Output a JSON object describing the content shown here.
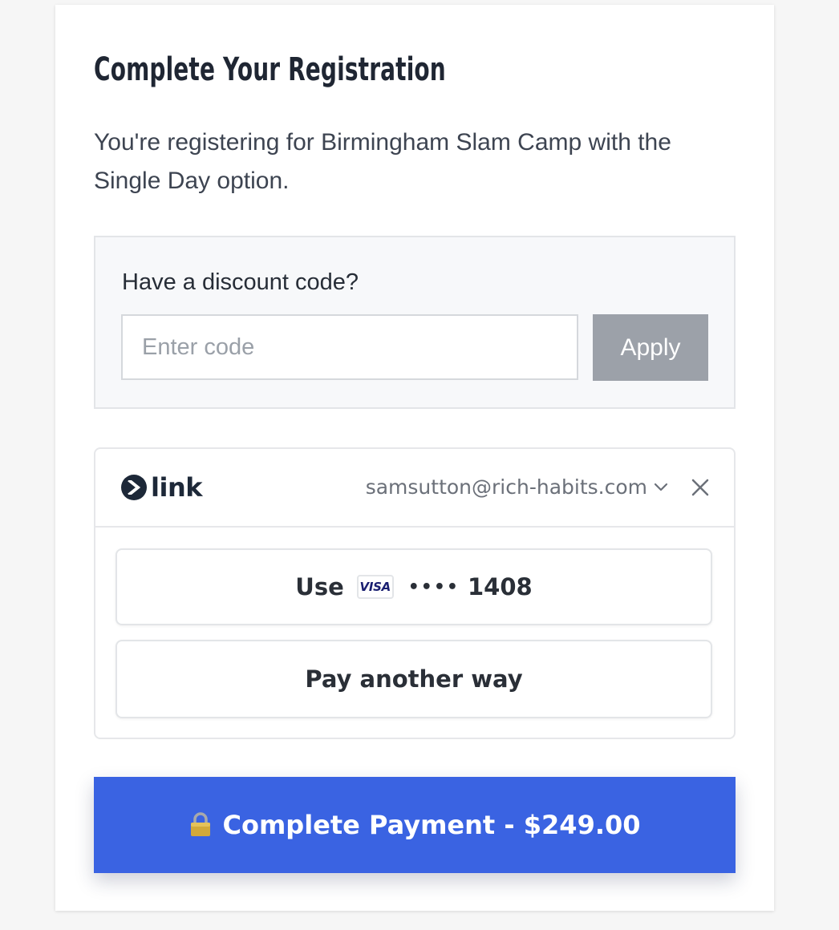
{
  "registration": {
    "title": "Complete Your Registration",
    "subtitle": "You're registering for Birmingham Slam Camp with the Single Day option."
  },
  "discount": {
    "label": "Have a discount code?",
    "input_placeholder": "Enter code",
    "input_value": "",
    "apply_label": "Apply"
  },
  "link": {
    "logo_text": "link",
    "email": "samsutton@rich-habits.com",
    "options": {
      "use_label": "Use",
      "card_brand": "VISA",
      "card_dots": "••••",
      "card_last4": "1408",
      "pay_another_label": "Pay another way"
    }
  },
  "payment": {
    "button_label": "Complete Payment - $249.00"
  },
  "colors": {
    "primary": "#3a63e2",
    "apply_disabled": "#9ca1a9",
    "link_dark": "#1d2838",
    "visa_blue": "#1a1f71"
  },
  "icons": {
    "link_logo": "link-arrow-icon",
    "email_dropdown": "chevron-down-icon",
    "close": "close-icon",
    "lock": "lock-icon"
  }
}
